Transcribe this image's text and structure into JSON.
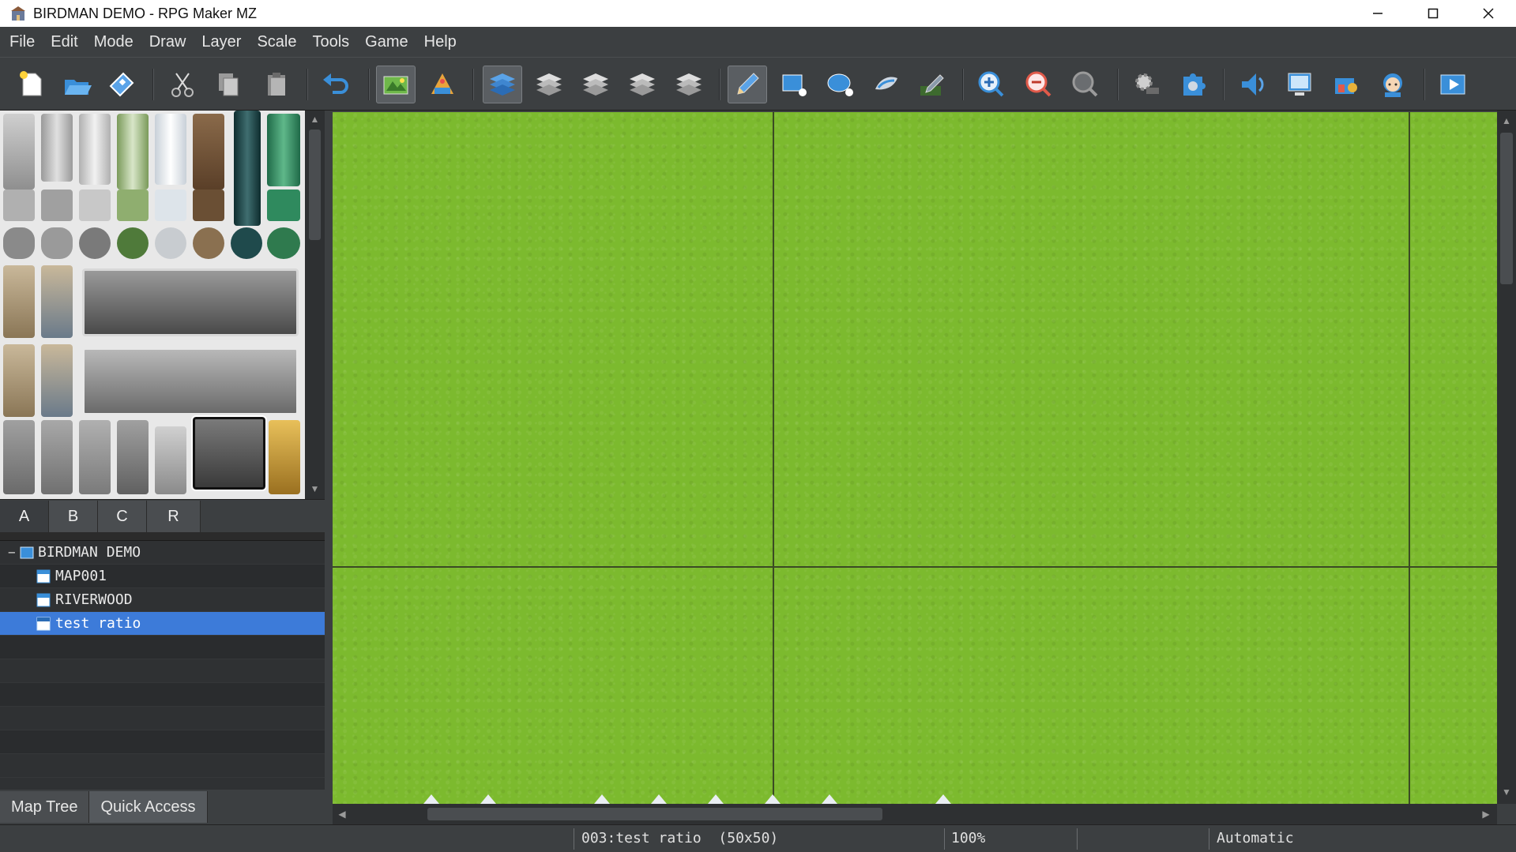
{
  "window": {
    "title": "BIRDMAN DEMO - RPG Maker MZ",
    "controls": [
      "minimize",
      "maximize",
      "close"
    ]
  },
  "menu": [
    "File",
    "Edit",
    "Mode",
    "Draw",
    "Layer",
    "Scale",
    "Tools",
    "Game",
    "Help"
  ],
  "toolbar": {
    "items": [
      "new-project-icon",
      "open-project-icon",
      "save-project-icon",
      "cut-icon",
      "copy-icon",
      "paste-icon",
      "undo-icon",
      "map-mode-icon",
      "event-mode-icon",
      "layer-auto-icon",
      "layer-1-icon",
      "layer-2-icon",
      "layer-3-icon",
      "layer-4-icon",
      "pencil-icon",
      "rectangle-icon",
      "ellipse-icon",
      "flood-fill-icon",
      "shadow-pen-icon",
      "zoom-in-icon",
      "zoom-out-icon",
      "actual-size-icon",
      "database-icon",
      "plugin-manager-icon",
      "sound-test-icon",
      "event-searcher-icon",
      "resource-manager-icon",
      "character-generator-icon",
      "playtest-icon"
    ],
    "active": [
      "map-mode-icon",
      "layer-auto-icon",
      "pencil-icon"
    ]
  },
  "tileset_tabs": [
    "A",
    "B",
    "C",
    "R"
  ],
  "map_tree": {
    "project": "BIRDMAN DEMO",
    "maps": [
      {
        "name": "MAP001",
        "selected": false
      },
      {
        "name": "RIVERWOOD",
        "selected": false
      },
      {
        "name": "test ratio",
        "selected": true
      }
    ]
  },
  "panel_tabs": [
    "Map Tree",
    "Quick Access"
  ],
  "panel_tab_active": "Quick Access",
  "status": {
    "map": "003:test ratio  (50x50)",
    "zoom": "100%",
    "mode": "Automatic"
  },
  "colors": {
    "grass": "#7cba2e",
    "selection": "#3d7bd9",
    "panel_bg": "#3c3f41"
  }
}
